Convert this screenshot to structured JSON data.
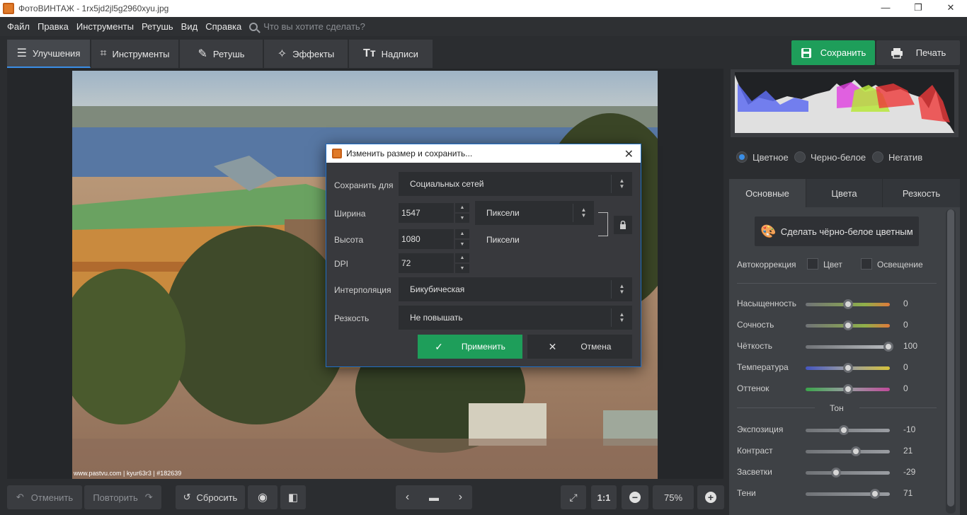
{
  "window": {
    "title": "ФотоВИНТАЖ - 1rx5jd2jl5g2960xyu.jpg",
    "min": "—",
    "max": "❐",
    "close": "✕"
  },
  "menu": {
    "items": [
      "Файл",
      "Правка",
      "Инструменты",
      "Ретушь",
      "Вид",
      "Справка"
    ],
    "search_placeholder": "Что вы хотите сделать?"
  },
  "tabs": [
    {
      "label": "Улучшения"
    },
    {
      "label": "Инструменты"
    },
    {
      "label": "Ретушь"
    },
    {
      "label": "Эффекты"
    },
    {
      "label": "Надписи"
    }
  ],
  "actions": {
    "save": "Сохранить",
    "print": "Печать"
  },
  "photo": {
    "credit": "www.pastvu.com | kyur63r3 | #182639"
  },
  "bottom": {
    "undo": "Отменить",
    "redo": "Повторить",
    "reset": "Сбросить",
    "ratio": "1:1",
    "zoom": "75%"
  },
  "modes": {
    "color": "Цветное",
    "bw": "Черно-белое",
    "negative": "Негатив"
  },
  "side_tabs": [
    "Основные",
    "Цвета",
    "Резкость"
  ],
  "panel": {
    "bw_button": "Сделать чёрно-белое цветным",
    "auto_label": "Автокоррекция",
    "auto_color": "Цвет",
    "auto_light": "Освещение",
    "tone_header": "Тон",
    "sliders": [
      {
        "label": "Насыщенность",
        "value": "0",
        "pos": 0.5
      },
      {
        "label": "Сочность",
        "value": "0",
        "pos": 0.5
      },
      {
        "label": "Чёткость",
        "value": "100",
        "pos": 0.98
      },
      {
        "label": "Температура",
        "value": "0",
        "pos": 0.5
      },
      {
        "label": "Оттенок",
        "value": "0",
        "pos": 0.5
      }
    ],
    "tone_sliders": [
      {
        "label": "Экспозиция",
        "value": "-10",
        "pos": 0.45
      },
      {
        "label": "Контраст",
        "value": "21",
        "pos": 0.6
      },
      {
        "label": "Засветки",
        "value": "-29",
        "pos": 0.36
      },
      {
        "label": "Тени",
        "value": "71",
        "pos": 0.82
      }
    ]
  },
  "dialog": {
    "title": "Изменить размер и сохранить...",
    "save_for_label": "Сохранить для",
    "save_for_value": "Социальных сетей",
    "width_label": "Ширина",
    "width_value": "1547",
    "width_unit": "Пиксели",
    "height_label": "Высота",
    "height_value": "1080",
    "height_unit": "Пиксели",
    "dpi_label": "DPI",
    "dpi_value": "72",
    "interp_label": "Интерполяция",
    "interp_value": "Бикубическая",
    "sharp_label": "Резкость",
    "sharp_value": "Не повышать",
    "apply": "Применить",
    "cancel": "Отмена"
  },
  "colors": {
    "accent": "#1e9e5a",
    "blue": "#3a8ee6"
  }
}
